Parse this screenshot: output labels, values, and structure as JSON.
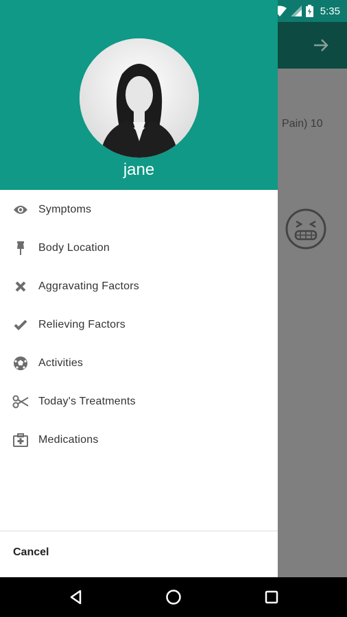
{
  "status_bar": {
    "time": "5:35",
    "icons": [
      "wifi-icon",
      "signal-icon",
      "battery-icon"
    ]
  },
  "background_app": {
    "partial_text": "Pain) 10"
  },
  "drawer": {
    "user_name": "jane",
    "menu_items": [
      {
        "label": "Symptoms",
        "icon": "eye-icon"
      },
      {
        "label": "Body Location",
        "icon": "pin-icon"
      },
      {
        "label": "Aggravating Factors",
        "icon": "x-icon"
      },
      {
        "label": "Relieving Factors",
        "icon": "check-icon"
      },
      {
        "label": "Activities",
        "icon": "soccer-ball-icon"
      },
      {
        "label": "Today's Treatments",
        "icon": "scissors-icon"
      },
      {
        "label": "Medications",
        "icon": "medical-kit-icon"
      }
    ],
    "cancel_label": "Cancel"
  },
  "colors": {
    "header": "#0f9986",
    "status_bar": "#0e7a6e",
    "scrim": "#7f7f7f"
  }
}
